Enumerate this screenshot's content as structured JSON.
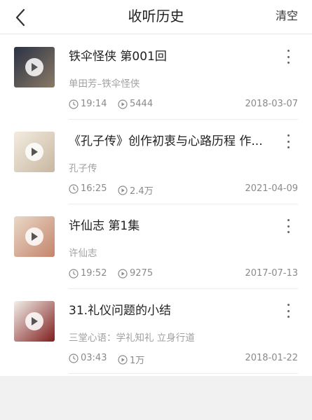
{
  "header": {
    "title": "收听历史",
    "clear_label": "清空",
    "back_icon": "chevron-left-icon"
  },
  "colors": {
    "header_bg": "#ffffff",
    "page_bg": "#f1f1f1",
    "muted_text": "#8a8a8a"
  },
  "items": [
    {
      "title": "铁伞怪侠 第001回",
      "author": "单田芳–铁伞怪侠",
      "duration": "19:14",
      "plays": "5444",
      "date": "2018-03-07",
      "thumb": [
        "#2a3244",
        "#8b7a66"
      ]
    },
    {
      "title": "《孔子传》创作初衷与心路历程 作...",
      "author": "孔子传",
      "duration": "16:25",
      "plays": "2.4万",
      "date": "2021-04-09",
      "thumb": [
        "#f3ece0",
        "#c8b7a0"
      ]
    },
    {
      "title": "许仙志 第1集",
      "author": "许仙志",
      "duration": "19:52",
      "plays": "9275",
      "date": "2017-07-13",
      "thumb": [
        "#e9d8c8",
        "#c4846a"
      ]
    },
    {
      "title": "31.礼仪问题的小结",
      "author": "三堂心语：学礼知礼 立身行道",
      "duration": "03:43",
      "plays": "1万",
      "date": "2018-01-22",
      "thumb": [
        "#f2efe9",
        "#7f1e1e"
      ]
    }
  ]
}
